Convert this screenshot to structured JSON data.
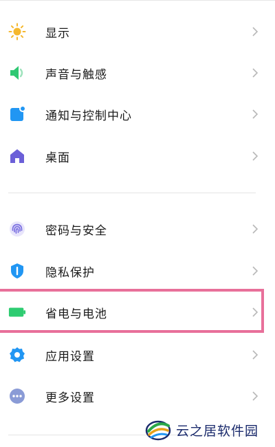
{
  "settings": {
    "group1": [
      {
        "label": "显示",
        "icon": "sun-icon",
        "icon_color": "#f5b82e"
      },
      {
        "label": "声音与触感",
        "icon": "speaker-icon",
        "icon_color": "#2fc873"
      },
      {
        "label": "通知与控制中心",
        "icon": "notification-icon",
        "icon_color": "#2196f3"
      },
      {
        "label": "桌面",
        "icon": "home-icon",
        "icon_color": "#6b5fd8"
      }
    ],
    "group2": [
      {
        "label": "密码与安全",
        "icon": "fingerprint-icon",
        "icon_color": "#7a6fe0"
      },
      {
        "label": "隐私保护",
        "icon": "privacy-shield-icon",
        "icon_color": "#2196f3"
      },
      {
        "label": "省电与电池",
        "icon": "battery-icon",
        "icon_color": "#2ecc71"
      },
      {
        "label": "应用设置",
        "icon": "gear-icon",
        "icon_color": "#2196f3"
      },
      {
        "label": "更多设置",
        "icon": "more-dots-icon",
        "icon_color": "#8a9bd6"
      }
    ]
  },
  "highlight_color": "#e8709a",
  "watermark": {
    "text": "云之居软件园"
  }
}
